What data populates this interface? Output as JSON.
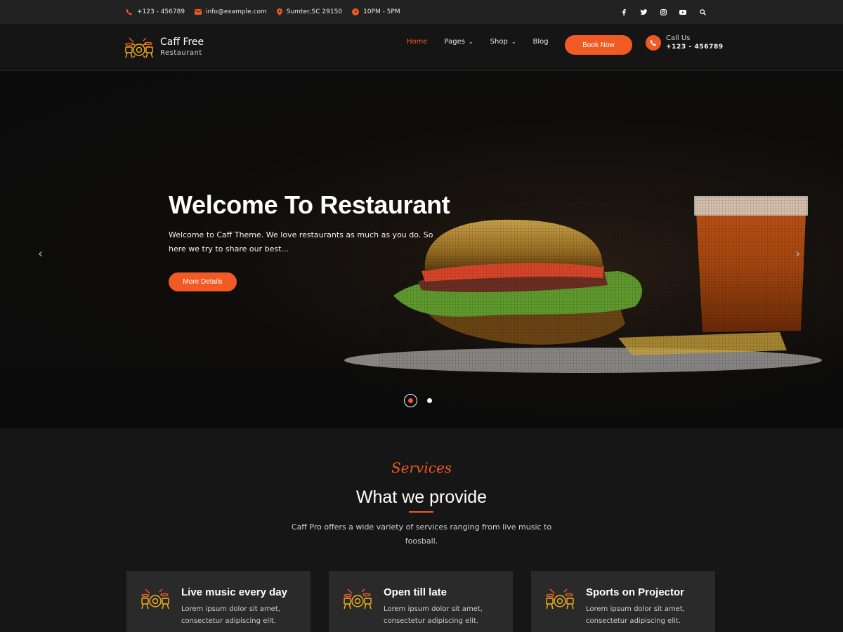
{
  "topbar": {
    "phone": "+123 - 456789",
    "email": "info@example.com",
    "location": "Sumter,SC 29150",
    "hours": "10PM - 5PM",
    "social_icons": [
      "facebook-icon",
      "twitter-icon",
      "instagram-icon",
      "youtube-icon",
      "search-icon"
    ]
  },
  "brand": {
    "title": "Caff Free",
    "subtitle": "Restaurant"
  },
  "nav": [
    {
      "label": "Home",
      "active": true
    },
    {
      "label": "Pages",
      "dropdown": true
    },
    {
      "label": "Shop",
      "dropdown": true
    },
    {
      "label": "Blog"
    }
  ],
  "header": {
    "book_label": "Book Now",
    "call_label": "Call Us",
    "call_number": "+123 - 456789"
  },
  "hero": {
    "title": "Welcome To Restaurant",
    "text": "Welcome to Caff Theme. We love restaurants as much as you do. So here we try to share our best...",
    "button": "More Details",
    "prev_arrow": "‹",
    "next_arrow": "›",
    "slides": 2,
    "active_slide": 1
  },
  "services": {
    "tag": "Services",
    "title": "What we provide",
    "description": "Caff Pro offers a wide variety of services ranging from live music to foosball.",
    "cards": [
      {
        "title": "Live music every day",
        "text": "Lorem ipsum dolor sit amet, consectetur adipiscing elit."
      },
      {
        "title": "Open till late",
        "text": "Lorem ipsum dolor sit amet, consectetur adipiscing elit."
      },
      {
        "title": "Sports on Projector",
        "text": "Lorem ipsum dolor sit amet, consectetur adipiscing elit."
      }
    ]
  },
  "colors": {
    "accent": "#f15a24",
    "background": "#161616",
    "topbar": "#222222",
    "card": "#2a2a2a"
  }
}
